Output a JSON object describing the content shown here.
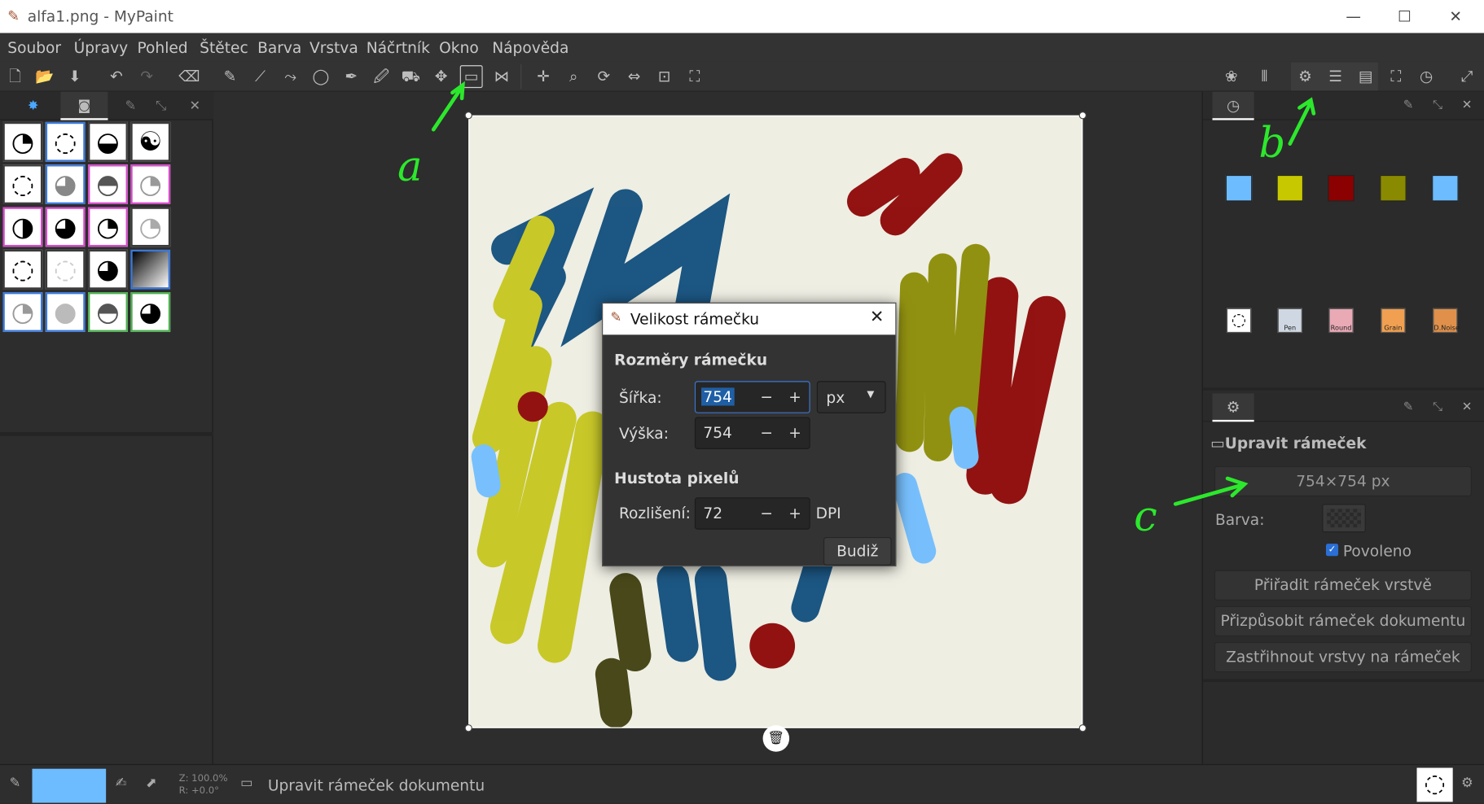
{
  "window": {
    "title": "alfa1.png - MyPaint",
    "minimize": "—",
    "maximize": "☐",
    "close": "✕"
  },
  "menu": [
    "Soubor",
    "Úpravy",
    "Pohled",
    "Štětec",
    "Barva",
    "Vrstva",
    "Náčrtník",
    "Okno",
    "Nápověda"
  ],
  "dialog": {
    "title": "Velikost rámečku",
    "close": "✕",
    "section_dimensions": "Rozměry rámečku",
    "width_label": "Šířka:",
    "width_value": "754",
    "height_label": "Výška:",
    "height_value": "754",
    "unit": "px",
    "section_density": "Hustota pixelů",
    "resolution_label": "Rozlišení:",
    "resolution_value": "72",
    "resolution_unit": "DPI",
    "ok": "Budiž",
    "minus": "−",
    "plus": "+"
  },
  "right_panel": {
    "swatches": [
      "#6dbcff",
      "#c8c800",
      "#8b0000",
      "#8a8a00",
      "#6dbcff"
    ],
    "frame_heading": "Upravit rámeček",
    "frame_size": "754×754 px",
    "color_label": "Barva:",
    "enabled_label": "Povoleno",
    "enabled": true,
    "btn_assign": "Přiřadit rámeček vrstvě",
    "btn_fit": "Přizpůsobit rámeček dokumentu",
    "btn_trim": "Zastřihnout vrstvy na rámeček"
  },
  "mini_brushes": [
    {
      "icon": "swirl"
    },
    {
      "label": "Pen"
    },
    {
      "label": "Round"
    },
    {
      "label": "Grain"
    },
    {
      "label": "D.Noise"
    }
  ],
  "status": {
    "current_color": "#6dbcff",
    "zoom": "Z: 100.0%",
    "rotation": "R: +0.0°",
    "message": "Upravit rámeček dokumentu"
  },
  "annotations": [
    "a",
    "b",
    "c"
  ],
  "accent": "#2ce82c"
}
